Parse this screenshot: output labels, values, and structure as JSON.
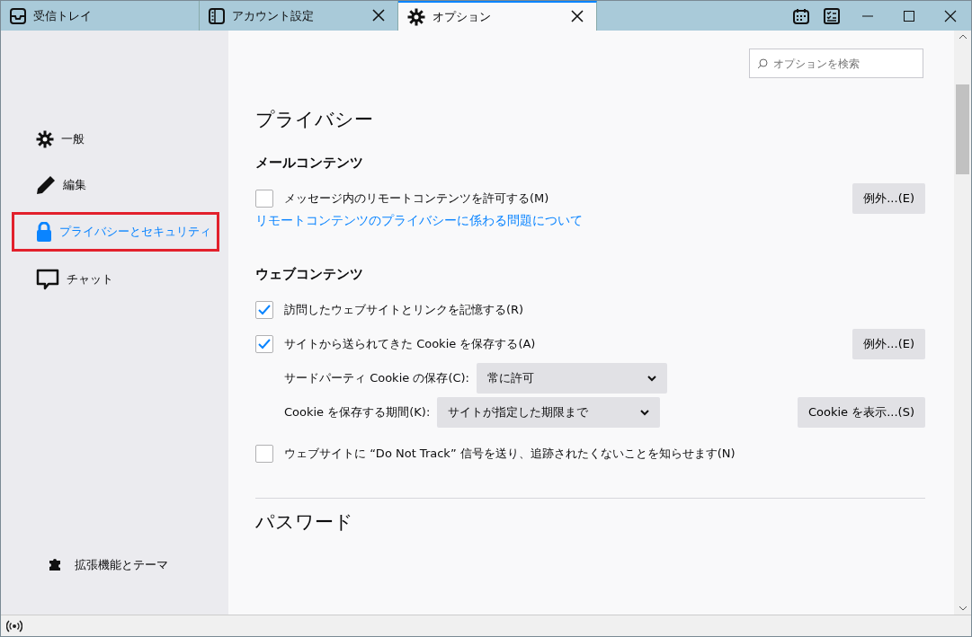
{
  "tabs": [
    {
      "label": "受信トレイ",
      "selected": false,
      "closable": false
    },
    {
      "label": "アカウント設定",
      "selected": false,
      "closable": true
    },
    {
      "label": "オプション",
      "selected": true,
      "closable": true
    }
  ],
  "search": {
    "placeholder": "オプションを検索"
  },
  "sidebar": {
    "items": [
      {
        "label": "一般",
        "selected": false
      },
      {
        "label": "編集",
        "selected": false
      },
      {
        "label": "プライバシーとセキュリティ",
        "selected": true
      },
      {
        "label": "チャット",
        "selected": false
      }
    ],
    "footer": {
      "label": "拡張機能とテーマ"
    }
  },
  "page_title": "プライバシー",
  "sections": [
    {
      "title": "メールコンテンツ",
      "rows": [
        {
          "kind": "checkbox",
          "label": "メッセージ内のリモートコンテンツを許可する(M)",
          "checked": false,
          "button": "例外...(E)"
        },
        {
          "kind": "link",
          "label": "リモートコンテンツのプライバシーに係わる問題について"
        }
      ]
    },
    {
      "title": "ウェブコンテンツ",
      "rows": [
        {
          "kind": "checkbox",
          "label": "訪問したウェブサイトとリンクを記憶する(R)",
          "checked": true
        },
        {
          "kind": "checkbox",
          "label": "サイトから送られてきた Cookie を保存する(A)",
          "checked": true,
          "button": "例外...(E)"
        },
        {
          "kind": "select",
          "label": "サードパーティ Cookie の保存(C):",
          "value": "常に許可"
        },
        {
          "kind": "select",
          "label": "Cookie を保存する期間(K):",
          "value": "サイトが指定した期限まで",
          "button": "Cookie を表示...(S)"
        },
        {
          "kind": "checkbox",
          "label": "ウェブサイトに “Do Not Track” 信号を送り、追跡されたくないことを知らせます(N)",
          "checked": false
        }
      ]
    }
  ],
  "next_title": "パスワード"
}
